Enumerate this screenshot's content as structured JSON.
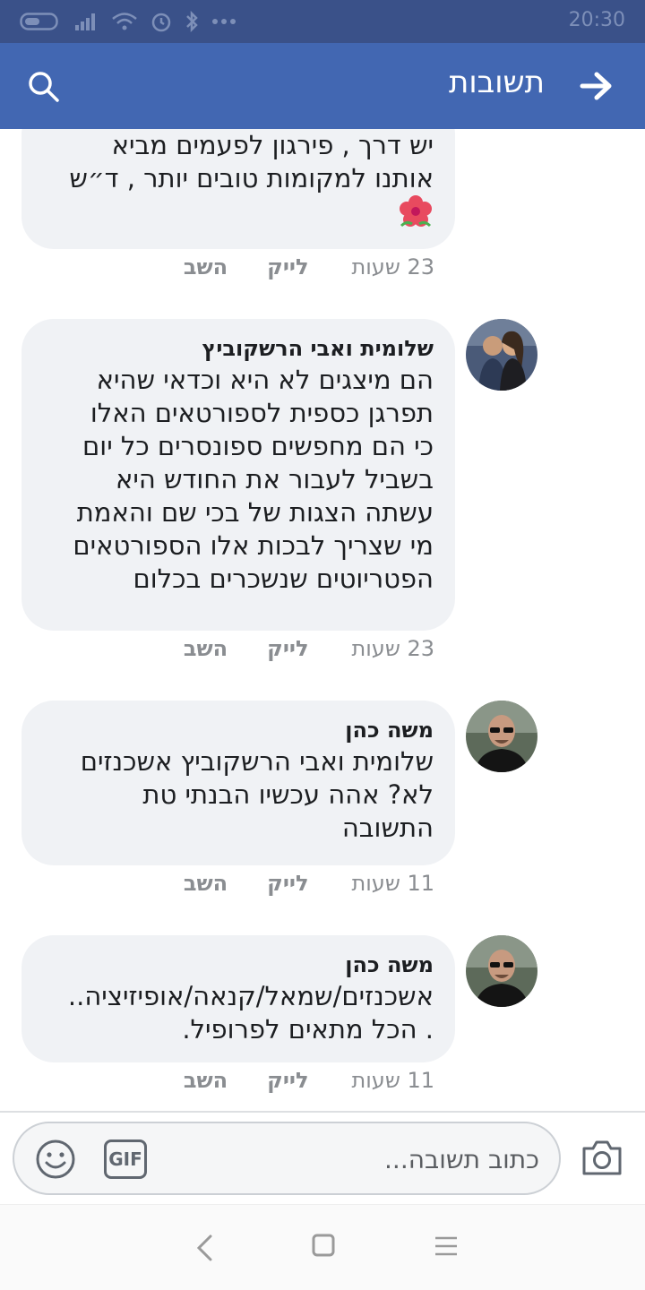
{
  "status_bar": {
    "time": "20:30",
    "icons": [
      "battery-icon",
      "signal-icon",
      "wifi-icon",
      "alarm-icon",
      "bluetooth-icon",
      "more-dots-icon"
    ]
  },
  "header": {
    "title": "תשובות",
    "back_icon": "arrow-right-icon",
    "search_icon": "search-icon",
    "color": "#4267b2"
  },
  "comments": [
    {
      "author": "",
      "text": "יש דרך , פירגון לפעמים מביא\nאותנו למקומות טובים יותר , ד״ש",
      "emoji": "flower-icon",
      "time": "23 שעות",
      "like": "לייק",
      "reply": "השב"
    },
    {
      "author": "שלומית ואבי הרשקוביץ",
      "text": "הם מיצגים לא היא וכדאי שהיא\nתפרגן כספית לספורטאים האלו\nכי הם מחפשים ספונסרים כל יום\nבשביל לעבור את החודש היא\nעשתה הצגות של בכי שם והאמת\nמי שצריך לבכות אלו הספורטאים\nהפטריוטים שנשכרים בכלום",
      "time": "23 שעות",
      "like": "לייק",
      "reply": "השב"
    },
    {
      "author": "משה כהן",
      "text": "שלומית ואבי הרשקוביץ אשכנזים\nלא? אהה עכשיו הבנתי טת\nהתשובה",
      "time": "11 שעות",
      "like": "לייק",
      "reply": "השב"
    },
    {
      "author": "משה כהן",
      "text": "אשכנזים/שמאל/קנאה/אופיזיציה..\n. הכל מתאים לפרופיל.",
      "time": "11 שעות",
      "like": "לייק",
      "reply": "השב"
    }
  ],
  "composer": {
    "placeholder": "כתוב תשובה...",
    "gif_label": "GIF",
    "camera_icon": "camera-icon",
    "emoji_icon": "smiley-icon"
  },
  "nav_bar": {
    "icons": [
      "nav-back-icon",
      "nav-home-icon",
      "nav-menu-icon"
    ]
  }
}
